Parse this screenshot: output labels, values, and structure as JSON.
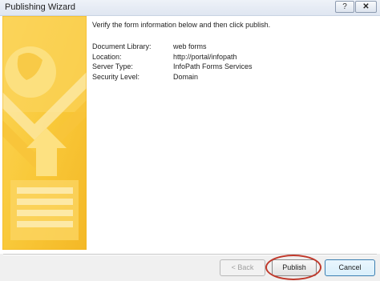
{
  "window": {
    "title": "Publishing Wizard",
    "help_label": "?",
    "close_label": "✕"
  },
  "main": {
    "instruction": "Verify the form information below and then click publish.",
    "info": [
      {
        "label": "Document Library:",
        "value": "web forms"
      },
      {
        "label": "Location:",
        "value": "http://portal/infopath"
      },
      {
        "label": "Server Type:",
        "value": "InfoPath Forms Services"
      },
      {
        "label": "Security Level:",
        "value": "Domain"
      }
    ]
  },
  "buttons": {
    "back": "< Back",
    "publish": "Publish",
    "cancel": "Cancel"
  },
  "colors": {
    "art_light": "#fde38a",
    "art_mid": "#f9c93a",
    "art_dark": "#f2b31c",
    "highlight": "#c0392b"
  },
  "icons": [
    "help-icon",
    "close-icon",
    "wizard-art-image"
  ]
}
